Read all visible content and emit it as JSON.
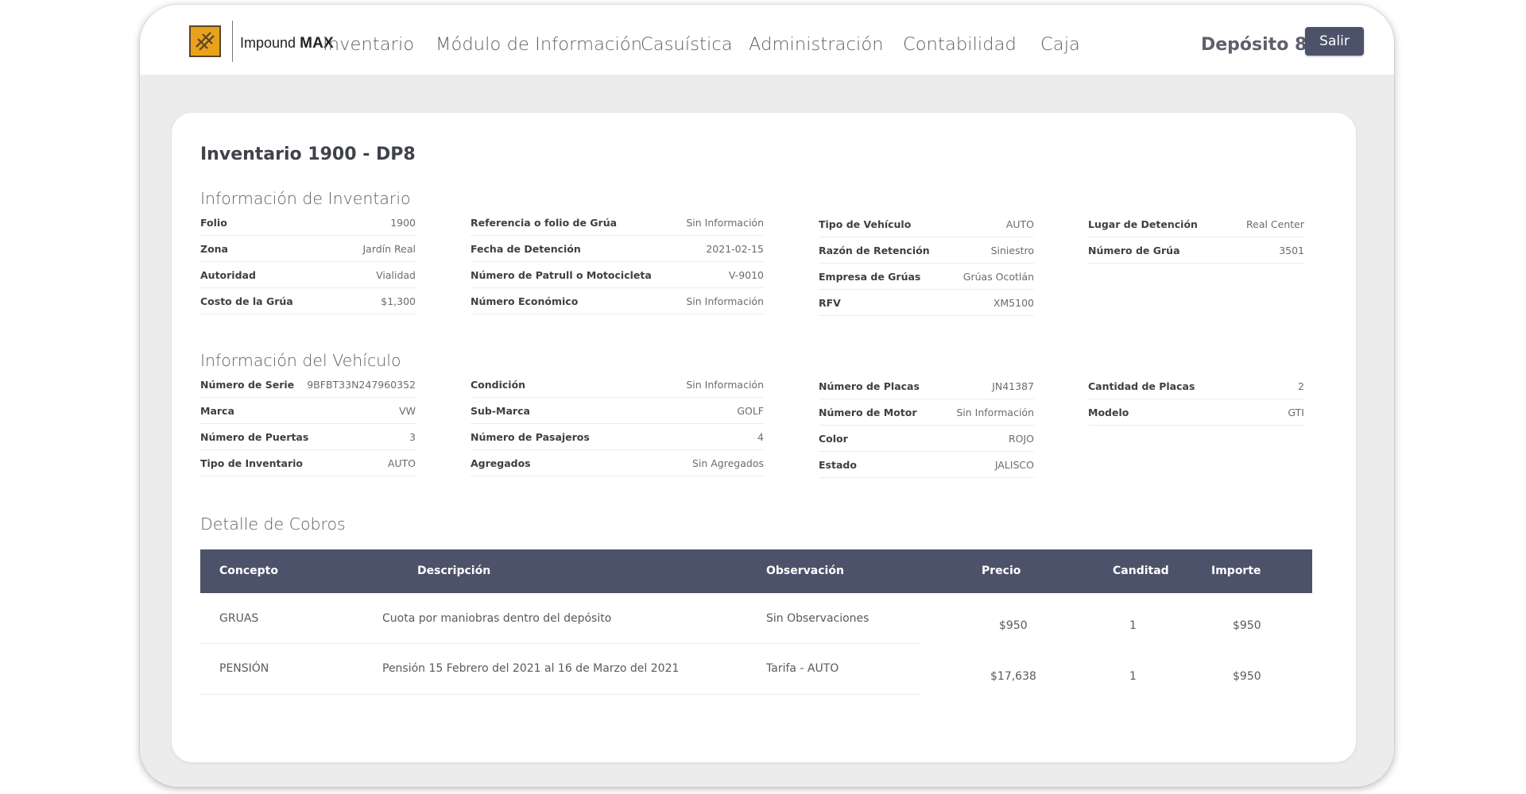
{
  "brand": {
    "name_light": "Impound",
    "name_bold": "MAX"
  },
  "nav": {
    "items": [
      "Inventario",
      "Módulo de Información",
      "Casuística",
      "Administración",
      "Contabilidad",
      "Caja"
    ],
    "depot": "Depósito 8",
    "logout_label": "Salir"
  },
  "page_title": "Inventario 1900 - DP8",
  "inventory": {
    "title": "Información de Inventario",
    "col1": [
      {
        "label": "Folio",
        "value": "1900"
      },
      {
        "label": "Zona",
        "value": "Jardín Real"
      },
      {
        "label": "Autoridad",
        "value": "Vialidad"
      },
      {
        "label": "Costo de la Grúa",
        "value": "$1,300"
      }
    ],
    "col2": [
      {
        "label": "Referencia o folio de Grúa",
        "value": "Sin Información"
      },
      {
        "label": "Fecha de Detención",
        "value": "2021-02-15"
      },
      {
        "label": "Número de Patrull o Motocicleta",
        "value": "V-9010"
      },
      {
        "label": "Número Económico",
        "value": "Sin Información"
      }
    ],
    "col3": [
      {
        "label": "Tipo de Vehículo",
        "value": "AUTO"
      },
      {
        "label": "Razón de Retención",
        "value": "Siniestro"
      },
      {
        "label": "Empresa de Grúas",
        "value": "Grúas Ocotlán"
      },
      {
        "label": "RFV",
        "value": "XM5100"
      }
    ],
    "col4": [
      {
        "label": "Lugar de Detención",
        "value": "Real Center"
      },
      {
        "label": "Número de Grúa",
        "value": "3501"
      }
    ]
  },
  "vehicle": {
    "title": "Información del Vehículo",
    "col1": [
      {
        "label": "Número de Serie",
        "value": "9BFBT33N247960352"
      },
      {
        "label": "Marca",
        "value": "VW"
      },
      {
        "label": "Número de Puertas",
        "value": "3"
      },
      {
        "label": "Tipo de Inventario",
        "value": "AUTO"
      }
    ],
    "col2": [
      {
        "label": "Condición",
        "value": "Sin Información"
      },
      {
        "label": "Sub-Marca",
        "value": "GOLF"
      },
      {
        "label": "Número de Pasajeros",
        "value": "4"
      },
      {
        "label": "Agregados",
        "value": "Sin Agregados"
      }
    ],
    "col3": [
      {
        "label": "Número de Placas",
        "value": "JN41387"
      },
      {
        "label": "Número de Motor",
        "value": "Sin Información"
      },
      {
        "label": "Color",
        "value": "ROJO"
      },
      {
        "label": "Estado",
        "value": "JALISCO"
      }
    ],
    "col4": [
      {
        "label": "Cantidad de Placas",
        "value": "2"
      },
      {
        "label": "Modelo",
        "value": "GTI"
      }
    ]
  },
  "charges": {
    "title": "Detalle de Cobros",
    "headers": [
      "Concepto",
      "Descripción",
      "Observación",
      "Precio",
      "Canditad",
      "Importe"
    ],
    "rows": [
      {
        "concepto": "GRUAS",
        "descripcion": "Cuota por maniobras dentro del depósito",
        "observacion": "Sin Observaciones",
        "precio": "$950",
        "cantidad": "1",
        "importe": "$950"
      },
      {
        "concepto": "PENSIÓN",
        "descripcion": "Pensión 15 Febrero del 2021 al 16 de Marzo del 2021",
        "observacion": "Tarifa - AUTO",
        "precio": "$17,638",
        "cantidad": "1",
        "importe": "$950"
      }
    ]
  },
  "colors": {
    "accent": "#4c5269",
    "logo": "#e9a21d"
  }
}
